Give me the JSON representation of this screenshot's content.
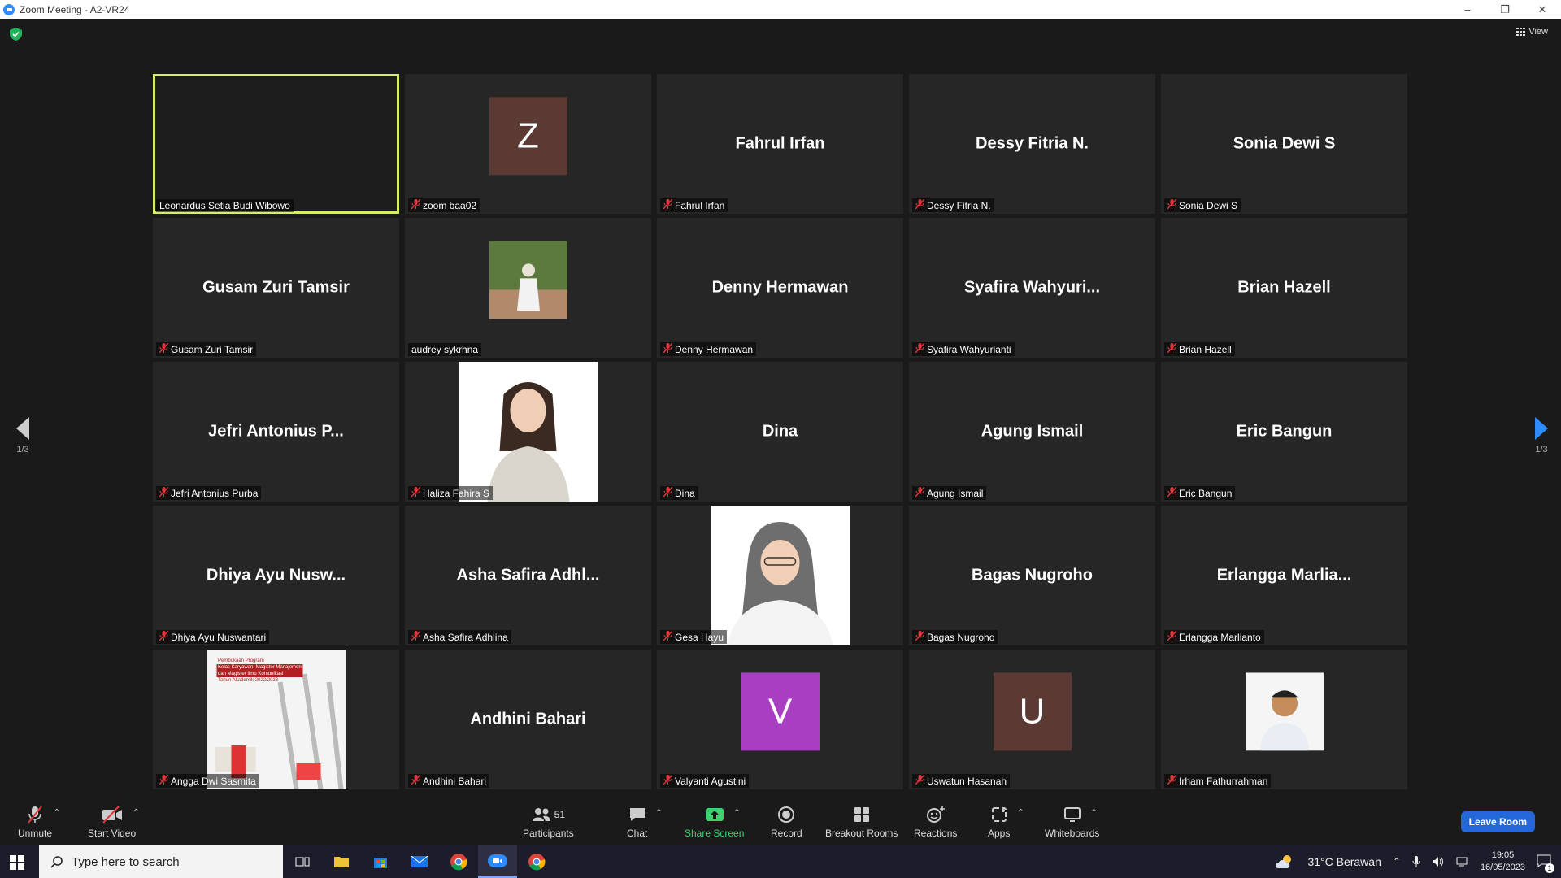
{
  "window": {
    "title": "Zoom Meeting - A2-VR24",
    "minimize": "–",
    "restore": "❐",
    "close": "✕"
  },
  "header": {
    "view_label": "View"
  },
  "pager": {
    "left": "1/3",
    "right": "1/3"
  },
  "participants_grid": [
    {
      "label": "Leonardus Setia Budi Wibowo",
      "display": "",
      "type": "blank",
      "muted": false,
      "active": true
    },
    {
      "label": "zoom baa02",
      "display": "Z",
      "type": "letter",
      "color": "#5a3a33",
      "muted": true
    },
    {
      "label": "Fahrul Irfan",
      "display": "Fahrul Irfan",
      "type": "name",
      "muted": true
    },
    {
      "label": "Dessy Fitria N.",
      "display": "Dessy Fitria N.",
      "type": "name",
      "muted": true
    },
    {
      "label": "Sonia Dewi S",
      "display": "Sonia Dewi S",
      "type": "name",
      "muted": true
    },
    {
      "label": "Gusam Zuri Tamsir",
      "display": "Gusam Zuri Tamsir",
      "type": "name",
      "muted": true
    },
    {
      "label": "audrey sykrhna",
      "display": "",
      "type": "smallphoto",
      "muted": false
    },
    {
      "label": "Denny Hermawan",
      "display": "Denny Hermawan",
      "type": "name",
      "muted": true
    },
    {
      "label": "Syafira Wahyurianti",
      "display": "Syafira  Wahyuri...",
      "type": "name",
      "muted": true
    },
    {
      "label": "Brian Hazell",
      "display": "Brian Hazell",
      "type": "name",
      "muted": true
    },
    {
      "label": "Jefri Antonius Purba",
      "display": "Jefri Antonius P...",
      "type": "name",
      "muted": true
    },
    {
      "label": "Haliza Fahira S",
      "display": "",
      "type": "photo",
      "muted": true
    },
    {
      "label": "Dina",
      "display": "Dina",
      "type": "name",
      "muted": true
    },
    {
      "label": "Agung Ismail",
      "display": "Agung Ismail",
      "type": "name",
      "muted": true
    },
    {
      "label": "Eric Bangun",
      "display": "Eric Bangun",
      "type": "name",
      "muted": true
    },
    {
      "label": "Dhiya Ayu Nuswantari",
      "display": "Dhiya Ayu Nusw...",
      "type": "name",
      "muted": true
    },
    {
      "label": "Asha Safira Adhlina",
      "display": "Asha Safira Adhl...",
      "type": "name",
      "muted": true
    },
    {
      "label": "Gesa Hayu",
      "display": "",
      "type": "photo",
      "muted": true
    },
    {
      "label": "Bagas Nugroho",
      "display": "Bagas Nugroho",
      "type": "name",
      "muted": true
    },
    {
      "label": "Erlangga Marlianto",
      "display": "Erlangga  Marlia...",
      "type": "name",
      "muted": true
    },
    {
      "label": "Angga Dwi Sasmita",
      "display": "",
      "type": "poster",
      "muted": true,
      "poster_lines": [
        "Pembukaan Program",
        "Kelas Karyawan, Magister Manajemen",
        "dan Magister Ilmu Komunikasi",
        "Tahun Akademik 2022/2023"
      ]
    },
    {
      "label": "Andhini Bahari",
      "display": "Andhini Bahari",
      "type": "name",
      "muted": true
    },
    {
      "label": "Valyanti Agustini",
      "display": "V",
      "type": "letter",
      "color": "#a83fc0",
      "muted": true
    },
    {
      "label": "Uswatun Hasanah",
      "display": "U",
      "type": "letter",
      "color": "#5a3a33",
      "muted": true
    },
    {
      "label": "Irham Fathurrahman",
      "display": "",
      "type": "smallphoto",
      "muted": true
    }
  ],
  "toolbar": {
    "unmute": "Unmute",
    "start_video": "Start Video",
    "participants": "Participants",
    "participants_count": "51",
    "chat": "Chat",
    "share_screen": "Share Screen",
    "record": "Record",
    "breakout_rooms": "Breakout Rooms",
    "reactions": "Reactions",
    "apps": "Apps",
    "whiteboards": "Whiteboards",
    "leave_room": "Leave Room"
  },
  "taskbar": {
    "search_placeholder": "Type here to search",
    "weather": "31°C  Berawan",
    "time": "19:05",
    "date": "16/05/2023",
    "notifications": "1"
  },
  "colors": {
    "active_border": "#d9ec6c",
    "share_green": "#3fd171",
    "leave_blue": "#2468d8",
    "mute_red": "#e0383e"
  }
}
